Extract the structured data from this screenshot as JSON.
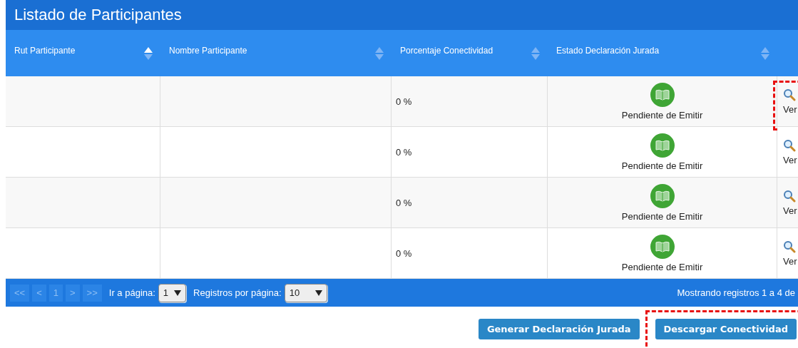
{
  "panel": {
    "title": "Listado de Participantes"
  },
  "table": {
    "columns": [
      {
        "label": "Rut Participante",
        "sorted": true
      },
      {
        "label": "Nombre Participante",
        "sorted": false
      },
      {
        "label": "Porcentaje Conectividad",
        "sorted": false
      },
      {
        "label": "Estado Declaración Jurada",
        "sorted": false
      }
    ],
    "rows": [
      {
        "percent": "0 %",
        "status": "Pendiente de Emitir",
        "action": "Ver",
        "highlighted": true
      },
      {
        "percent": "0 %",
        "status": "Pendiente de Emitir",
        "action": "Ver",
        "highlighted": false
      },
      {
        "percent": "0 %",
        "status": "Pendiente de Emitir",
        "action": "Ver",
        "highlighted": false
      },
      {
        "percent": "0 %",
        "status": "Pendiente de Emitir",
        "action": "Ver",
        "highlighted": false
      }
    ]
  },
  "pager": {
    "buttons": [
      {
        "label": "<<",
        "disabled": true
      },
      {
        "label": "<",
        "disabled": true
      },
      {
        "label": "1",
        "disabled": true
      },
      {
        "label": ">",
        "disabled": true
      },
      {
        "label": ">>",
        "disabled": true
      }
    ],
    "goto_label": "Ir a página:",
    "page_value": "1",
    "per_page_label": "Registros por página:",
    "per_page_value": "10",
    "summary": "Mostrando registros 1 a 4 de"
  },
  "buttons": [
    {
      "label": "Generar Declaración Jurada",
      "highlighted": false
    },
    {
      "label": "Descargar Conectividad",
      "highlighted": true
    }
  ]
}
